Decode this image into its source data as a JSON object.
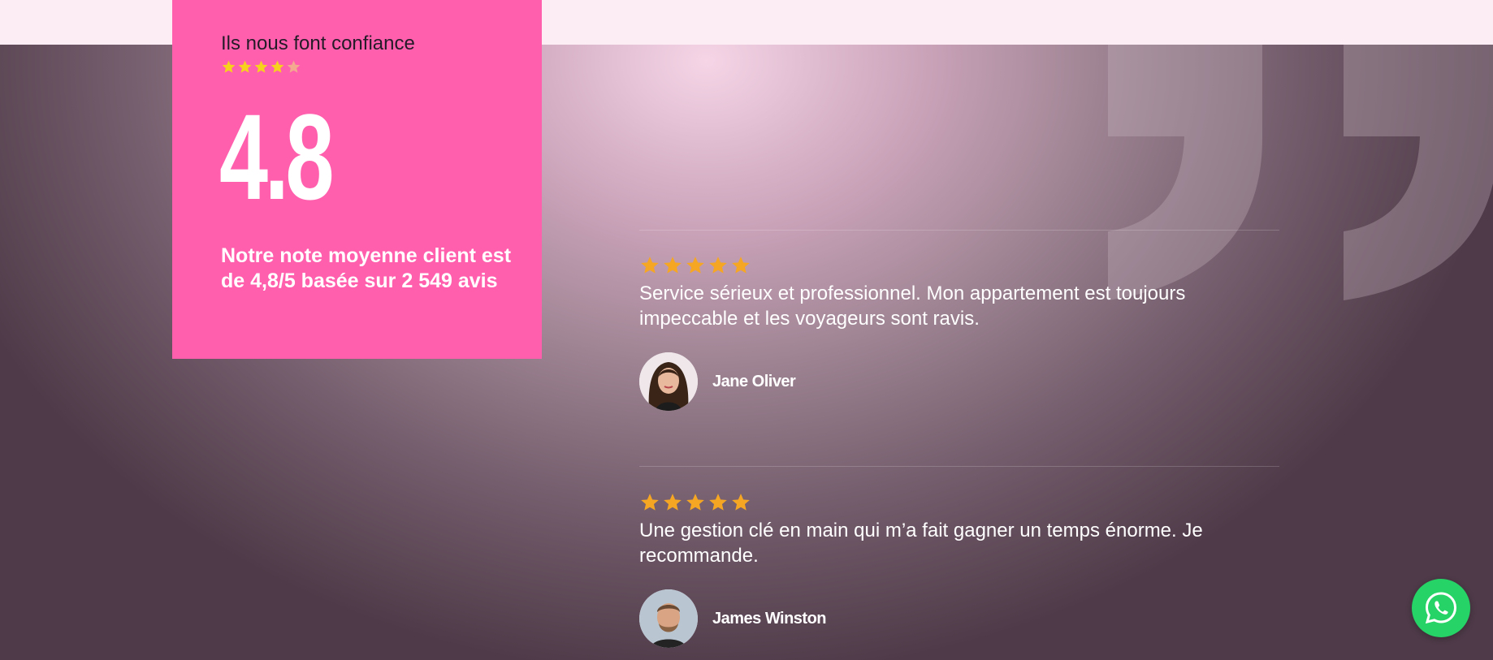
{
  "card": {
    "heading": "Ils nous font confiance",
    "stars": 4.5,
    "score": "4.8",
    "summary": "Notre note moyenne client est de 4,8/5 basée sur 2 549 avis"
  },
  "reviews": [
    {
      "stars": 5,
      "text": "Service sérieux et professionnel. Mon appartement est toujours impeccable et les voyageurs sont ravis.",
      "author": "Jane Oliver"
    },
    {
      "stars": 5,
      "text": "Une gestion clé en main qui m’a fait gagner un temps énorme. Je recommande.",
      "author": "James Winston"
    }
  ],
  "colors": {
    "card_background": "#ff5fad",
    "card_star": "#f7d21c",
    "review_star": "#f5a623",
    "whatsapp": "#25d366"
  },
  "icons": {
    "quote": "quote-icon",
    "star": "star-icon",
    "whatsapp": "whatsapp-icon"
  }
}
